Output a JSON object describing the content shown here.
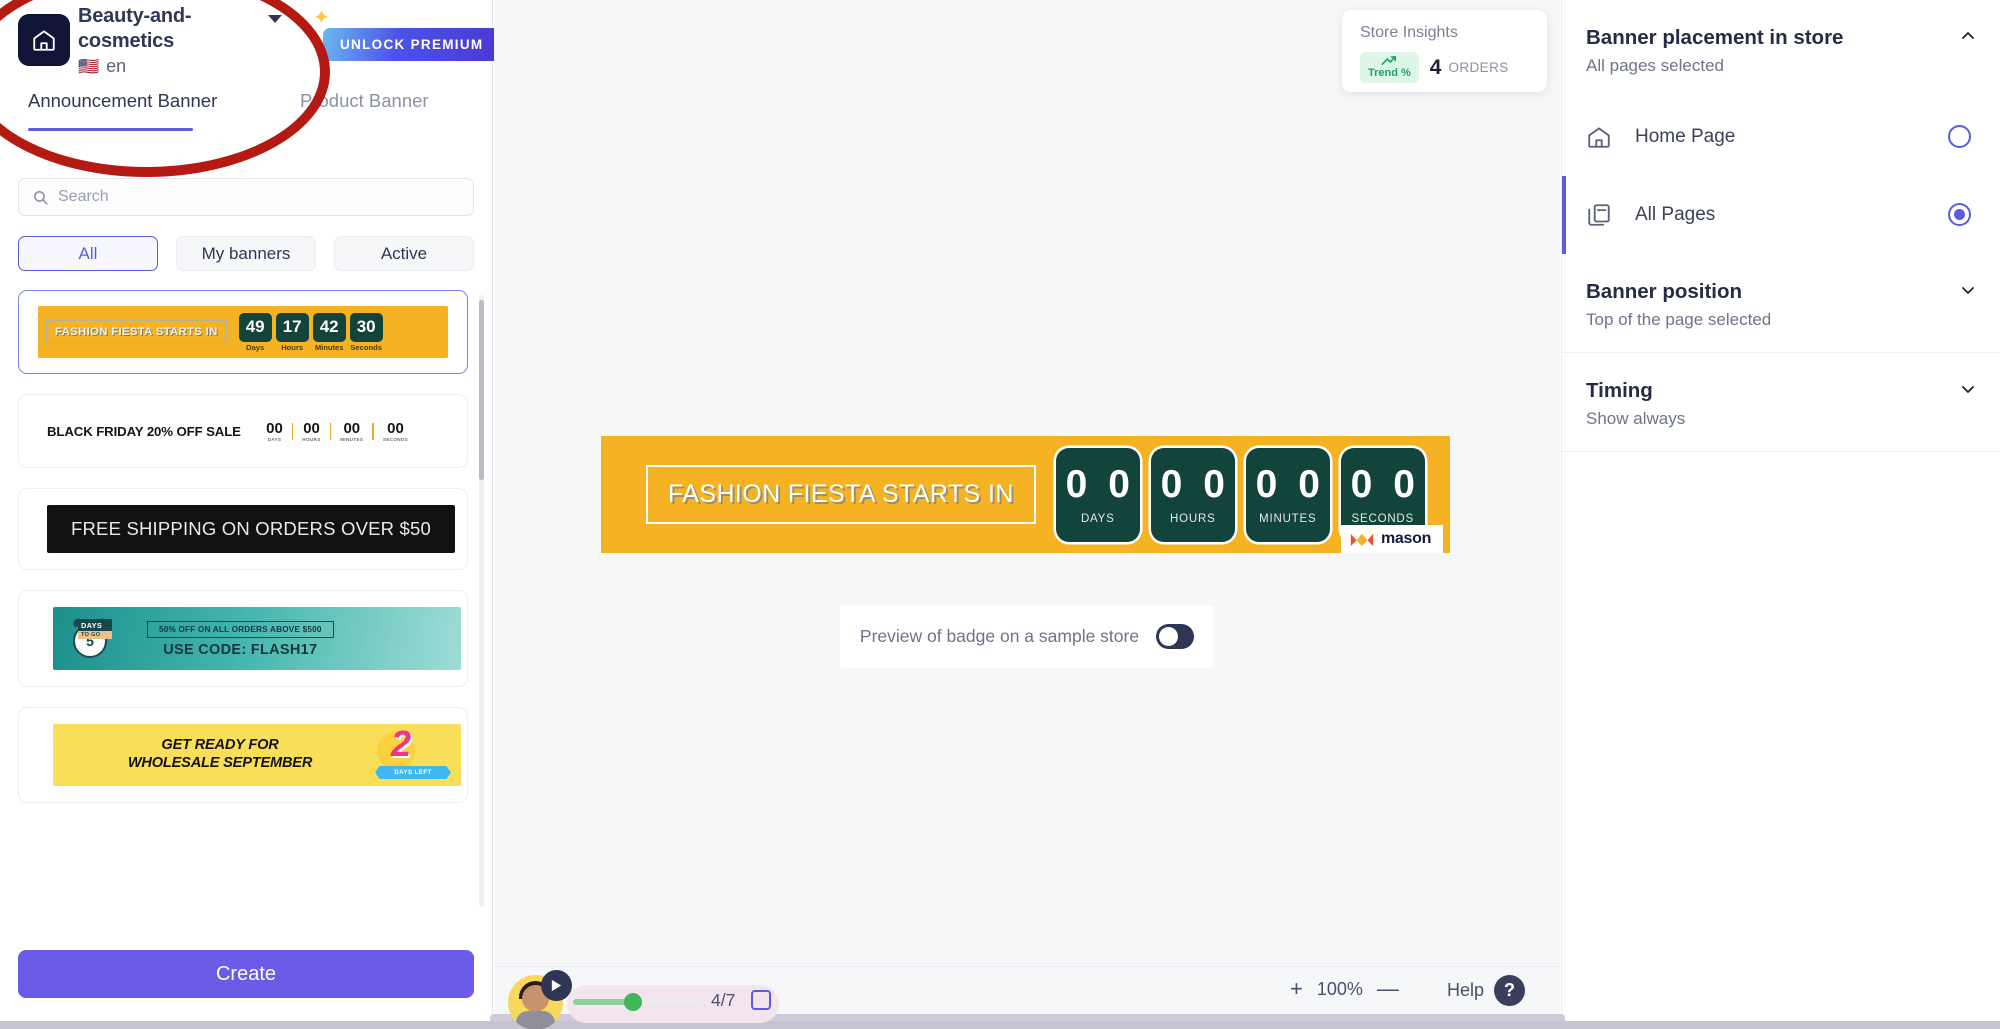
{
  "header": {
    "store_name": "Beauty-and-cosmetics",
    "language": "en",
    "flag_icon": "us-flag-icon",
    "caret_icon": "chevron-down-icon",
    "home_icon": "home-icon",
    "premium_label": "UNLOCK PREMIUM",
    "sparkle_icon": "sparkle-icon"
  },
  "tabs": [
    {
      "label": "Announcement Banner",
      "active": true
    },
    {
      "label": "Product Banner",
      "active": false
    }
  ],
  "search": {
    "placeholder": "Search",
    "value": "",
    "icon": "search-icon"
  },
  "filters": [
    {
      "label": "All",
      "active": true
    },
    {
      "label": "My banners",
      "active": false
    },
    {
      "label": "Active",
      "active": false
    }
  ],
  "banners": [
    {
      "name": "fashion-fiesta-countdown",
      "selected": true,
      "headline": "FASHION FIESTA STARTS IN",
      "countdown": [
        {
          "value": "49",
          "label": "Days"
        },
        {
          "value": "17",
          "label": "Hours"
        },
        {
          "value": "42",
          "label": "Minutes"
        },
        {
          "value": "30",
          "label": "Seconds"
        }
      ]
    },
    {
      "name": "black-friday-sale",
      "selected": false,
      "headline": "BLACK FRIDAY 20% OFF SALE",
      "countdown": [
        {
          "value": "00",
          "label": "DAYS"
        },
        {
          "value": "00",
          "label": "HOURS"
        },
        {
          "value": "00",
          "label": "MINUTES"
        },
        {
          "value": "00",
          "label": "SECONDS"
        }
      ]
    },
    {
      "name": "free-shipping",
      "selected": false,
      "headline": "FREE SHIPPING ON ORDERS OVER $50"
    },
    {
      "name": "flash-sale-teal",
      "selected": false,
      "days_number": "5",
      "days_label": "DAYS",
      "days_sub": "TO GO",
      "offer": "50% OFF ON ALL ORDERS ABOVE $500",
      "code": "USE CODE: FLASH17"
    },
    {
      "name": "wholesale-september",
      "selected": false,
      "line1": "GET READY FOR",
      "line2": "WHOLESALE SEPTEMBER",
      "badge_number": "2",
      "badge_ribbon": "DAYS LEFT"
    }
  ],
  "create_button": "Create",
  "insights": {
    "title": "Store Insights",
    "trend_label": "Trend %",
    "trend_icon": "trend-up-icon",
    "count": "4",
    "count_label": "ORDERS"
  },
  "preview": {
    "headline": "FASHION FIESTA STARTS IN",
    "countdown": [
      {
        "value": "0 0",
        "label": "DAYS"
      },
      {
        "value": "0 0",
        "label": "HOURS"
      },
      {
        "value": "0 0",
        "label": "MINUTES"
      },
      {
        "value": "0 0",
        "label": "SECONDS"
      }
    ],
    "watermark": "mason",
    "toggle_label": "Preview of badge on a sample store",
    "toggle_on": false
  },
  "bottom_bar": {
    "step_count": "4/7",
    "zoom_level": "100%",
    "zoom_in_icon": "plus-icon",
    "zoom_out_icon": "minus-icon",
    "help_label": "Help",
    "help_icon": "question-mark-icon",
    "play_icon": "play-icon",
    "avatar_icon": "avatar"
  },
  "right_panel": {
    "placement": {
      "title": "Banner placement in store",
      "subtitle": "All pages selected",
      "chevron": "chevron-up-icon",
      "options": [
        {
          "label": "Home Page",
          "icon": "home-icon",
          "selected": false
        },
        {
          "label": "All Pages",
          "icon": "pages-icon",
          "selected": true
        }
      ]
    },
    "position": {
      "title": "Banner position",
      "subtitle": "Top of the page selected",
      "chevron": "chevron-down-icon"
    },
    "timing": {
      "title": "Timing",
      "subtitle": "Show always",
      "chevron": "chevron-down-icon"
    }
  },
  "annotation": {
    "shape": "ellipse",
    "color": "#b51a12"
  },
  "colors": {
    "accent": "#5b5ce2",
    "create": "#6b5ce7",
    "banner_yellow": "#f5b324",
    "countdown_green": "#12443c",
    "annotation_red": "#b51a12"
  }
}
